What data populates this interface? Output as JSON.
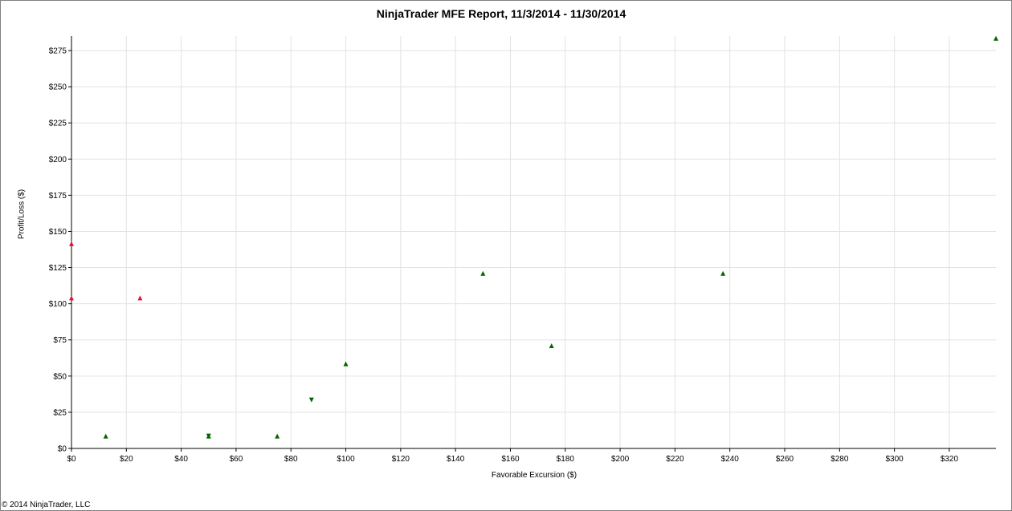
{
  "chart_data": {
    "type": "scatter",
    "title": "NinjaTrader MFE Report, 11/3/2014 - 11/30/2014",
    "xlabel": "Favorable Excursion ($)",
    "ylabel": "Profit/Loss ($)",
    "xlim": [
      0,
      337
    ],
    "ylim": [
      0,
      285
    ],
    "x_ticks": [
      0,
      20,
      40,
      60,
      80,
      100,
      120,
      140,
      160,
      180,
      200,
      220,
      240,
      260,
      280,
      300,
      320
    ],
    "x_tick_labels": [
      "$0",
      "$20",
      "$40",
      "$60",
      "$80",
      "$100",
      "$120",
      "$140",
      "$160",
      "$180",
      "$200",
      "$220",
      "$240",
      "$260",
      "$280",
      "$300",
      "$320"
    ],
    "y_ticks": [
      0,
      25,
      50,
      75,
      100,
      125,
      150,
      175,
      200,
      225,
      250,
      275
    ],
    "y_tick_labels": [
      "$0",
      "$25",
      "$50",
      "$75",
      "$100",
      "$125",
      "$150",
      "$175",
      "$200",
      "$225",
      "$250",
      "$275"
    ],
    "grid": true,
    "series": [
      {
        "color": "#006400",
        "points": [
          {
            "x": 12.5,
            "y": 8.5,
            "marker": "up"
          },
          {
            "x": 50,
            "y": 8.5,
            "marker": "up"
          },
          {
            "x": 50,
            "y": 8.5,
            "marker": "down"
          },
          {
            "x": 75,
            "y": 8.5,
            "marker": "up"
          },
          {
            "x": 87.5,
            "y": 33.5,
            "marker": "down"
          },
          {
            "x": 100,
            "y": 58.5,
            "marker": "up"
          },
          {
            "x": 150,
            "y": 121,
            "marker": "up"
          },
          {
            "x": 175,
            "y": 71,
            "marker": "up"
          },
          {
            "x": 237.5,
            "y": 121,
            "marker": "up"
          },
          {
            "x": 337,
            "y": 283.5,
            "marker": "up"
          }
        ]
      },
      {
        "color": "#dc143c",
        "points": [
          {
            "x": 0,
            "y": 141.5,
            "marker": "up"
          },
          {
            "x": 0,
            "y": 104,
            "marker": "up"
          },
          {
            "x": 25,
            "y": 104,
            "marker": "up"
          }
        ]
      }
    ]
  },
  "footer": {
    "copyright": "© 2014 NinjaTrader, LLC"
  }
}
